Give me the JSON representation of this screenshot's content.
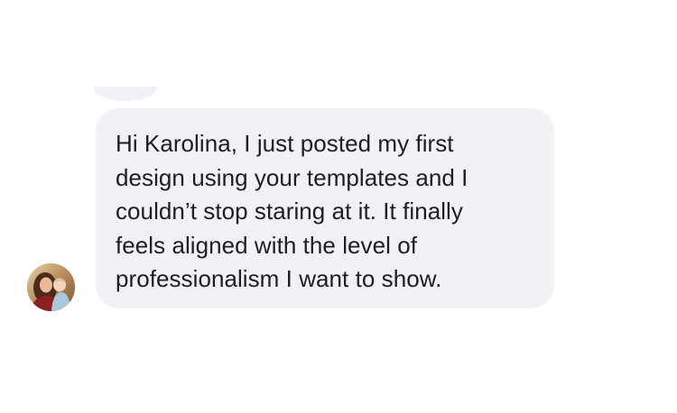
{
  "conversation": {
    "messages": [
      {
        "sender": "incoming",
        "avatar_icon": "user-avatar-photo",
        "lines": [
          "Hi Karolina, I just posted my first",
          "design using your templates and I",
          "couldn’t stop staring at it. It finally",
          "feels aligned with the level of",
          "professionalism I want to show."
        ]
      }
    ]
  },
  "colors": {
    "bubble_background": "#f1f2f5",
    "text": "#1c1e21",
    "page_background": "#ffffff"
  }
}
